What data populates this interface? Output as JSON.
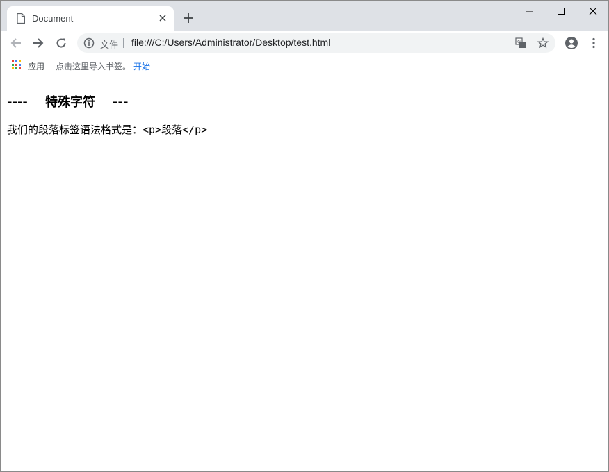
{
  "tab": {
    "title": "Document"
  },
  "omnibox": {
    "scheme_label": "文件",
    "url": "file:///C:/Users/Administrator/Desktop/test.html"
  },
  "bookmarks": {
    "apps_label": "应用",
    "import_text": "点击这里导入书签。",
    "start_link": "开始"
  },
  "page": {
    "heading": "----    特殊字符    ---",
    "paragraph_prefix": "我们的段落标签语法格式是：",
    "paragraph_code": "<p>段落</p>"
  },
  "colors": {
    "tabstrip_bg": "#dee1e6",
    "omnibox_bg": "#f1f3f4",
    "link": "#1a73e8"
  }
}
